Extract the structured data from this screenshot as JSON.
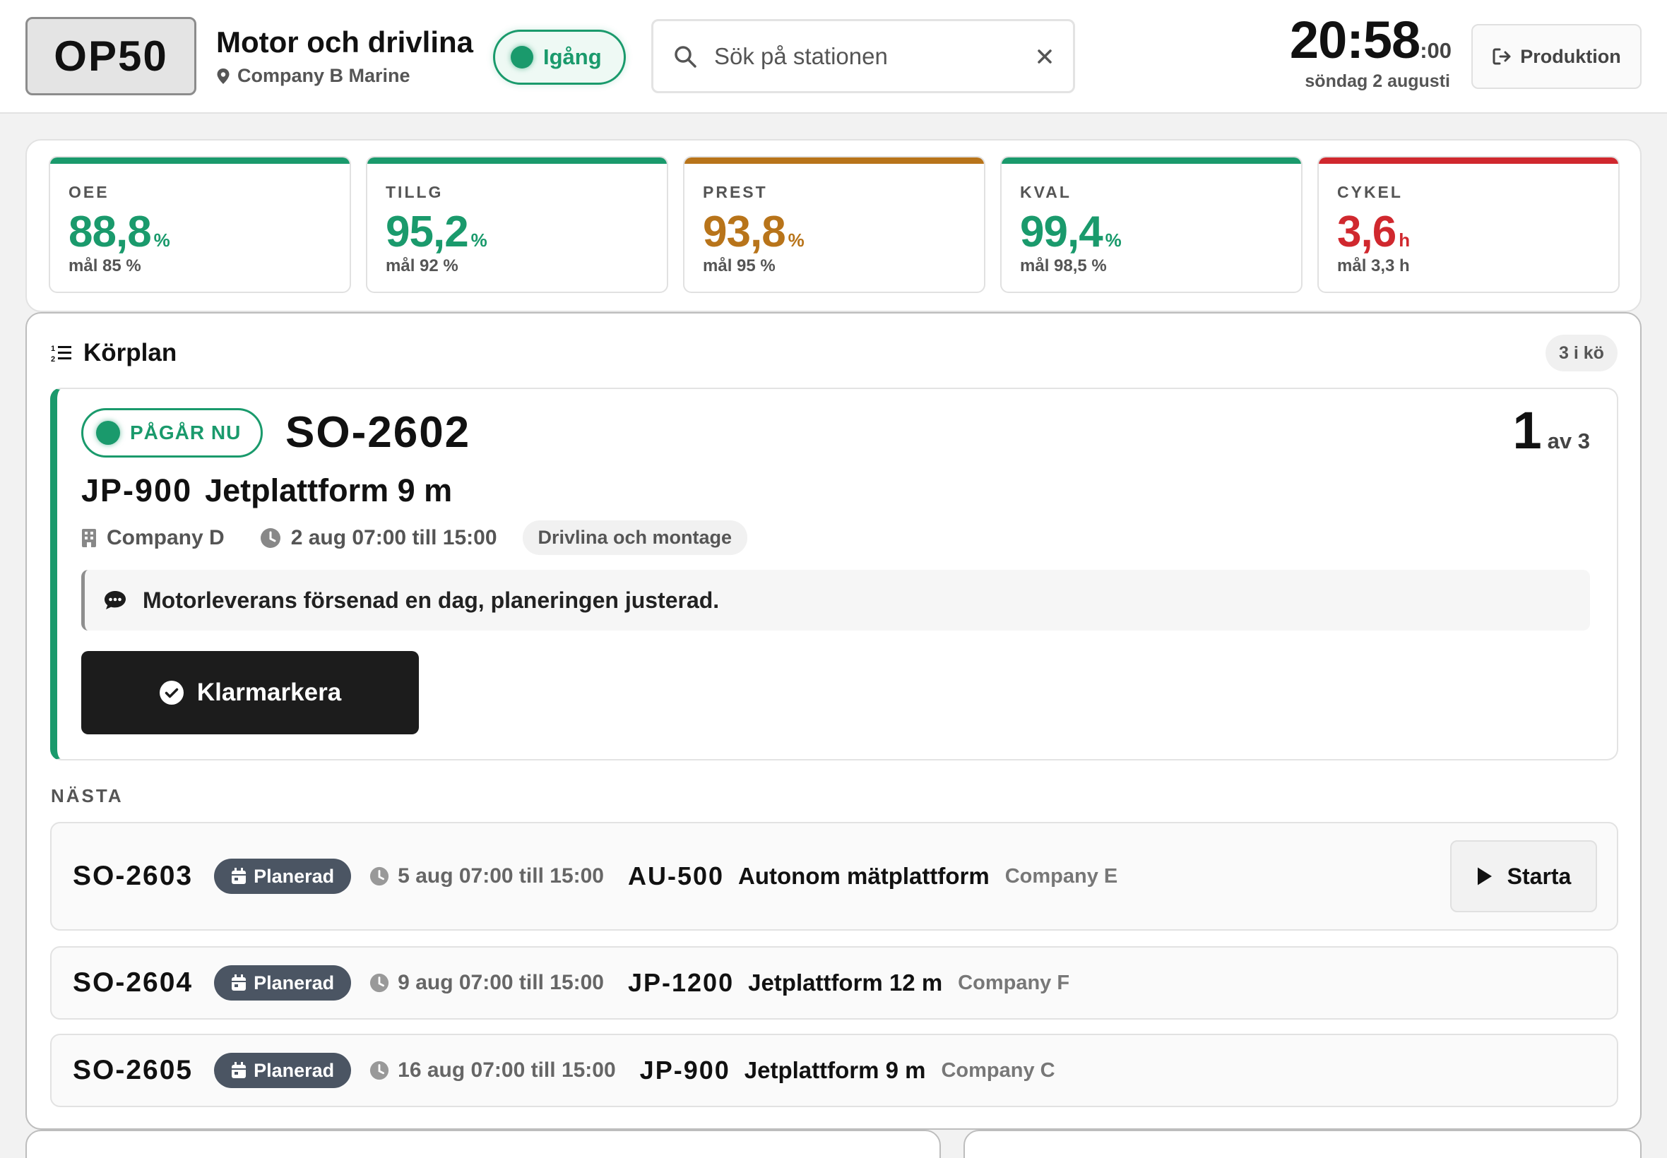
{
  "header": {
    "station": "OP50",
    "line_title": "Motor och drivlina",
    "location": "Company B Marine",
    "status": "Igång",
    "search_placeholder": "Sök på stationen",
    "clock_hm": "20:58",
    "clock_s": ":00",
    "date": "söndag 2 augusti",
    "production_button": "Produktion"
  },
  "colors": {
    "green": "#1a9a6c",
    "amber": "#b8741a",
    "red": "#d0282e"
  },
  "kpis": [
    {
      "label": "OEE",
      "value": "88,8",
      "unit": "%",
      "goal": "mål 85 %",
      "status": "green"
    },
    {
      "label": "TILLG",
      "value": "95,2",
      "unit": "%",
      "goal": "mål 92 %",
      "status": "green"
    },
    {
      "label": "PREST",
      "value": "93,8",
      "unit": "%",
      "goal": "mål 95 %",
      "status": "amber"
    },
    {
      "label": "KVAL",
      "value": "99,4",
      "unit": "%",
      "goal": "mål 98,5 %",
      "status": "green"
    },
    {
      "label": "CYKEL",
      "value": "3,6",
      "unit": "h",
      "goal": "mål 3,3 h",
      "status": "red"
    }
  ],
  "plan": {
    "title": "Körplan",
    "queue": "3 i kö",
    "current": {
      "status": "PÅGÅR NU",
      "order": "SO-2602",
      "position": "1",
      "position_of": "av 3",
      "product_code": "JP-900",
      "product_name": "Jetplattform 9 m",
      "customer": "Company D",
      "time": "2 aug 07:00 till 15:00",
      "tag": "Drivlina och montage",
      "note": "Motorleverans försenad en dag, planeringen justerad.",
      "done_button": "Klarmarkera"
    },
    "next_label": "NÄSTA",
    "next": [
      {
        "order": "SO-2603",
        "status": "Planerad",
        "time": "5 aug 07:00 till 15:00",
        "code": "AU-500",
        "name": "Autonom mätplattform",
        "customer": "Company E",
        "start_label": "Starta"
      },
      {
        "order": "SO-2604",
        "status": "Planerad",
        "time": "9 aug 07:00 till 15:00",
        "code": "JP-1200",
        "name": "Jetplattform 12 m",
        "customer": "Company F"
      },
      {
        "order": "SO-2605",
        "status": "Planerad",
        "time": "16 aug 07:00 till 15:00",
        "code": "JP-900",
        "name": "Jetplattform 9 m",
        "customer": "Company C"
      }
    ]
  }
}
